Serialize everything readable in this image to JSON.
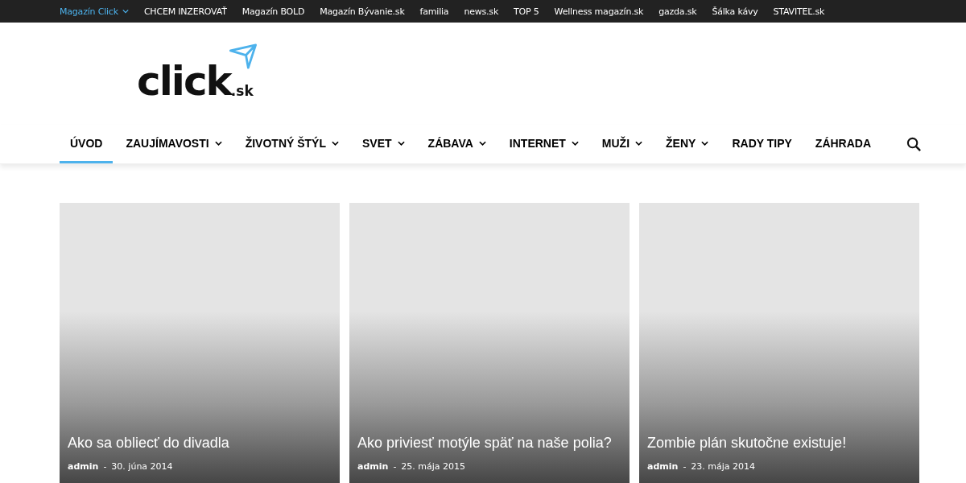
{
  "top_bar": {
    "items": [
      {
        "label": "Magazín Click",
        "selected": true,
        "has_dropdown": true
      },
      {
        "label": "CHCEM INZEROVAŤ",
        "selected": false,
        "has_dropdown": false
      },
      {
        "label": "Magazín BOLD",
        "selected": false,
        "has_dropdown": false
      },
      {
        "label": "Magazín Bývanie.sk",
        "selected": false,
        "has_dropdown": false
      },
      {
        "label": "familia",
        "selected": false,
        "has_dropdown": false
      },
      {
        "label": "news.sk",
        "selected": false,
        "has_dropdown": false
      },
      {
        "label": "TOP 5",
        "selected": false,
        "has_dropdown": false
      },
      {
        "label": "Wellness magazín.sk",
        "selected": false,
        "has_dropdown": false
      },
      {
        "label": "gazda.sk",
        "selected": false,
        "has_dropdown": false
      },
      {
        "label": "Šálka kávy",
        "selected": false,
        "has_dropdown": false
      },
      {
        "label": "STAVITEĽ.sk",
        "selected": false,
        "has_dropdown": false
      }
    ]
  },
  "logo": {
    "name": "click",
    "suffix": ".sk"
  },
  "nav": {
    "items": [
      {
        "label": "ÚVOD",
        "selected": true,
        "has_dropdown": false
      },
      {
        "label": "ZAUJÍMAVOSTI",
        "selected": false,
        "has_dropdown": true
      },
      {
        "label": "ŽIVOTNÝ ŠTÝL",
        "selected": false,
        "has_dropdown": true
      },
      {
        "label": "SVET",
        "selected": false,
        "has_dropdown": true
      },
      {
        "label": "ZÁBAVA",
        "selected": false,
        "has_dropdown": true
      },
      {
        "label": "INTERNET",
        "selected": false,
        "has_dropdown": true
      },
      {
        "label": "MUŽI",
        "selected": false,
        "has_dropdown": true
      },
      {
        "label": "ŽENY",
        "selected": false,
        "has_dropdown": true
      },
      {
        "label": "RADY TIPY",
        "selected": false,
        "has_dropdown": false
      },
      {
        "label": "ZÁHRADA",
        "selected": false,
        "has_dropdown": false
      }
    ]
  },
  "articles": [
    {
      "title": "Ako sa obliecť do divadla",
      "author": "admin",
      "separator": "-",
      "date": "30. júna 2014"
    },
    {
      "title": "Ako priviesť motýle späť na naše polia?",
      "author": "admin",
      "separator": "-",
      "date": "25. mája 2015"
    },
    {
      "title": "Zombie plán skutočne existuje!",
      "author": "admin",
      "separator": "-",
      "date": "23. mája 2014"
    }
  ]
}
